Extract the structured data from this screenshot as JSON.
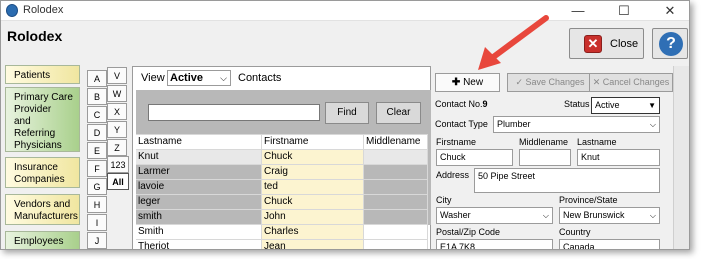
{
  "window": {
    "title": "Rolodex"
  },
  "header": {
    "title": "Rolodex",
    "close_label": "Close",
    "help_label": "?"
  },
  "nav_tabs": [
    {
      "label": "Patients",
      "style": "yellow"
    },
    {
      "label": "Primary Care Provider and Referring Physicians",
      "lines": [
        "Primary Care",
        "Provider",
        "and",
        "Referring",
        "Physicians"
      ],
      "style": "green"
    },
    {
      "lines": [
        "Insurance",
        "Companies"
      ],
      "style": "yellow"
    },
    {
      "lines": [
        "Vendors and",
        "Manufacturers"
      ],
      "style": "yellow"
    },
    {
      "lines": [
        "Employees"
      ],
      "style": "green"
    }
  ],
  "az_buttons": [
    "A",
    "V",
    "B",
    "W",
    "C",
    "X",
    "D",
    "Y",
    "E",
    "Z",
    "F",
    "123",
    "G",
    "All",
    "H",
    "I",
    "J"
  ],
  "view": {
    "label": "View",
    "value": "Active",
    "contacts_label": "Contacts"
  },
  "search": {
    "find_label": "Find",
    "clear_label": "Clear",
    "value": ""
  },
  "grid": {
    "columns": [
      "Lastname",
      "Firstname",
      "Middlename"
    ],
    "rows": [
      [
        "Knut",
        "Chuck",
        ""
      ],
      [
        "Larmer",
        "Craig",
        ""
      ],
      [
        "lavoie",
        "ted",
        ""
      ],
      [
        "leger",
        "Chuck",
        ""
      ],
      [
        "smith",
        "John",
        ""
      ],
      [
        "Smith",
        "Charles",
        ""
      ],
      [
        "Theriot",
        "Jean",
        ""
      ]
    ]
  },
  "toolbar": {
    "new_label": "New",
    "save_label": "Save Changes",
    "cancel_label": "Cancel Changes"
  },
  "contact": {
    "no_label": "Contact No.",
    "no_value": "9",
    "status_label": "Status",
    "status_value": "Active",
    "type_label": "Contact Type",
    "type_value": "Plumber",
    "first_label": "Firstname",
    "first_value": "Chuck",
    "middle_label": "Middlename",
    "middle_value": "",
    "last_label": "Lastname",
    "last_value": "Knut",
    "address_label": "Address",
    "address_value": "50 Pipe Street",
    "city_label": "City",
    "city_value": "Washer",
    "province_label": "Province/State",
    "province_value": "New Brunswick",
    "postal_label": "Postal/Zip Code",
    "postal_value": "E1A 7K8",
    "country_label": "Country",
    "country_value": "Canada"
  },
  "colors": {
    "close_red": "#c9302c",
    "help_blue": "#2f6fb5",
    "arrow_red": "#e8473c",
    "search_bg": "#b8b8b8"
  }
}
